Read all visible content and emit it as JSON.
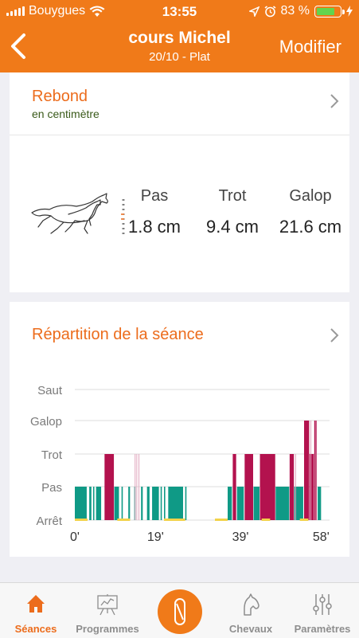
{
  "status": {
    "carrier": "Bouygues",
    "time": "13:55",
    "battery": "83 %"
  },
  "nav": {
    "title": "cours Michel",
    "subtitle": "20/10 - Plat",
    "edit": "Modifier"
  },
  "rebond": {
    "title": "Rebond",
    "subtitle": "en centimètre",
    "gaits": [
      {
        "name": "Pas",
        "value": "1.8 cm"
      },
      {
        "name": "Trot",
        "value": "9.4 cm"
      },
      {
        "name": "Galop",
        "value": "21.6 cm"
      }
    ]
  },
  "repartition": {
    "title": "Répartition de la séance"
  },
  "chart_data": {
    "type": "timeline",
    "levels": [
      "Saut",
      "Galop",
      "Trot",
      "Pas",
      "Arrêt"
    ],
    "x_ticks": [
      "0'",
      "19'",
      "39'",
      "58'"
    ],
    "xlim": [
      0,
      60
    ],
    "colors": {
      "pas": "#0f9a86",
      "trot": "#b3124e",
      "galop": "#b3124e",
      "arret": "#f2d24a",
      "grid": "#dddddd"
    },
    "segments": [
      {
        "start": 0.0,
        "end": 2.8,
        "level": "Pas"
      },
      {
        "start": 3.4,
        "end": 3.9,
        "level": "Pas"
      },
      {
        "start": 4.3,
        "end": 4.6,
        "level": "Pas"
      },
      {
        "start": 5.0,
        "end": 6.2,
        "level": "Pas"
      },
      {
        "start": 7.0,
        "end": 9.2,
        "level": "Trot"
      },
      {
        "start": 9.3,
        "end": 10.4,
        "level": "Pas"
      },
      {
        "start": 11.0,
        "end": 11.3,
        "level": "Pas"
      },
      {
        "start": 12.6,
        "end": 13.0,
        "level": "Pas"
      },
      {
        "start": 14.0,
        "end": 14.3,
        "level": "Pas"
      },
      {
        "start": 15.6,
        "end": 16.0,
        "level": "Pas"
      },
      {
        "start": 17.0,
        "end": 17.6,
        "level": "Pas"
      },
      {
        "start": 18.2,
        "end": 19.8,
        "level": "Pas"
      },
      {
        "start": 20.2,
        "end": 20.5,
        "level": "Pas"
      },
      {
        "start": 21.0,
        "end": 21.3,
        "level": "Pas"
      },
      {
        "start": 22.0,
        "end": 25.5,
        "level": "Pas"
      },
      {
        "start": 26.0,
        "end": 26.3,
        "level": "Pas"
      },
      {
        "start": 36.0,
        "end": 37.0,
        "level": "Pas"
      },
      {
        "start": 37.2,
        "end": 38.0,
        "level": "Trot"
      },
      {
        "start": 38.2,
        "end": 39.8,
        "level": "Pas"
      },
      {
        "start": 40.0,
        "end": 42.0,
        "level": "Trot"
      },
      {
        "start": 42.1,
        "end": 43.5,
        "level": "Pas"
      },
      {
        "start": 43.6,
        "end": 47.2,
        "level": "Trot"
      },
      {
        "start": 47.3,
        "end": 50.5,
        "level": "Pas"
      },
      {
        "start": 50.6,
        "end": 51.6,
        "level": "Trot"
      },
      {
        "start": 51.7,
        "end": 53.8,
        "level": "Pas"
      },
      {
        "start": 54.0,
        "end": 55.2,
        "level": "Galop"
      },
      {
        "start": 55.3,
        "end": 56.3,
        "level": "Trot"
      },
      {
        "start": 56.4,
        "end": 57.0,
        "level": "Galop"
      },
      {
        "start": 57.2,
        "end": 58.0,
        "level": "Pas"
      }
    ],
    "stops": [
      {
        "start": 0.0,
        "end": 3.0
      },
      {
        "start": 10.0,
        "end": 13.0
      },
      {
        "start": 21.0,
        "end": 26.0
      },
      {
        "start": 33.0,
        "end": 36.0
      },
      {
        "start": 44.0,
        "end": 46.0
      },
      {
        "start": 53.0,
        "end": 55.0
      }
    ],
    "thin_lines": [
      {
        "x": 14.2,
        "level": "Trot"
      },
      {
        "x": 14.6,
        "level": "Trot"
      },
      {
        "x": 15.1,
        "level": "Trot"
      },
      {
        "x": 52.0,
        "level": "Trot"
      },
      {
        "x": 55.6,
        "level": "Galop"
      },
      {
        "x": 56.8,
        "level": "Galop"
      }
    ]
  },
  "tabs": [
    {
      "label": "Séances",
      "icon": "home-icon",
      "active": true
    },
    {
      "label": "Programmes",
      "icon": "board-icon",
      "active": false
    },
    {
      "label": "",
      "icon": "record-icon",
      "active": false
    },
    {
      "label": "Chevaux",
      "icon": "horse-head-icon",
      "active": false
    },
    {
      "label": "Paramètres",
      "icon": "sliders-icon",
      "active": false
    }
  ]
}
